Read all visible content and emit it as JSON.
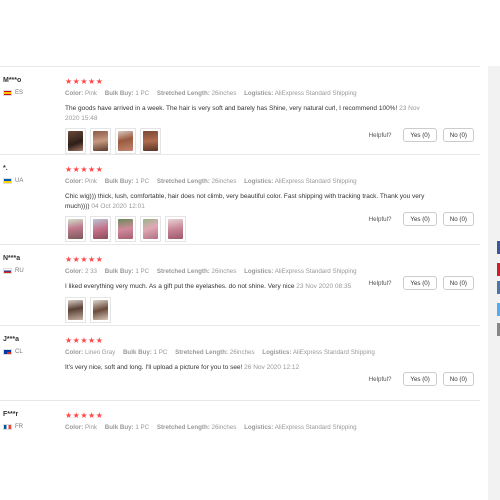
{
  "helpful_label": "Helpful?",
  "yes_label": "Yes (0)",
  "no_label": "No (0)",
  "attr_labels": {
    "color": "Color:",
    "bulk_buy": "Bulk Buy:",
    "stretched_length": "Stretched Length:",
    "logistics": "Logistics:"
  },
  "colors": {
    "stars": "#ff4747",
    "muted": "#999999"
  },
  "reviews": [
    {
      "name": "M***o",
      "country": "ES",
      "stars": "★★★★★",
      "color": "Pink",
      "bulk_buy": "1 PC",
      "stretched_length": "26inches",
      "logistics": "AliExpress Standard Shipping",
      "text": "The goods have arrived in a week. The hair is very soft and barely has Shine, very natural curl, I recommend 100%!",
      "date": "23 Nov 2020 15:48",
      "photos": 4
    },
    {
      "name": "*.",
      "country": "UA",
      "stars": "★★★★★",
      "color": "Pink",
      "bulk_buy": "1 PC",
      "stretched_length": "26inches",
      "logistics": "AliExpress Standard Shipping",
      "text": "Chic wig))) thick, lush, comfortable, hair does not climb, very beautiful color. Fast shipping with tracking track. Thank you very much))))",
      "date": "04 Oct 2020 12:01",
      "photos": 5
    },
    {
      "name": "N***a",
      "country": "RU",
      "stars": "★★★★★",
      "color": "2 33",
      "bulk_buy": "1 PC",
      "stretched_length": "26inches",
      "logistics": "AliExpress Standard Shipping",
      "text": "I liked everything very much. As a gift put the eyelashes. do not shine. Very nice",
      "date": "23 Nov 2020 08:35",
      "photos": 2
    },
    {
      "name": "J***a",
      "country": "CL",
      "stars": "★★★★★",
      "color": "Linen Gray",
      "bulk_buy": "1 PC",
      "stretched_length": "26inches",
      "logistics": "AliExpress Standard Shipping",
      "text": "It's very nice, soft and long. I'll upload a picture for you to see!",
      "date": "26 Nov 2020 12:12",
      "photos": 0
    },
    {
      "name": "F***r",
      "country": "FR",
      "stars": "★★★★★",
      "color": "Pink",
      "bulk_buy": "1 PC",
      "stretched_length": "26inches",
      "logistics": "AliExpress Standard Shipping",
      "text": "",
      "date": "",
      "photos": 0
    }
  ]
}
